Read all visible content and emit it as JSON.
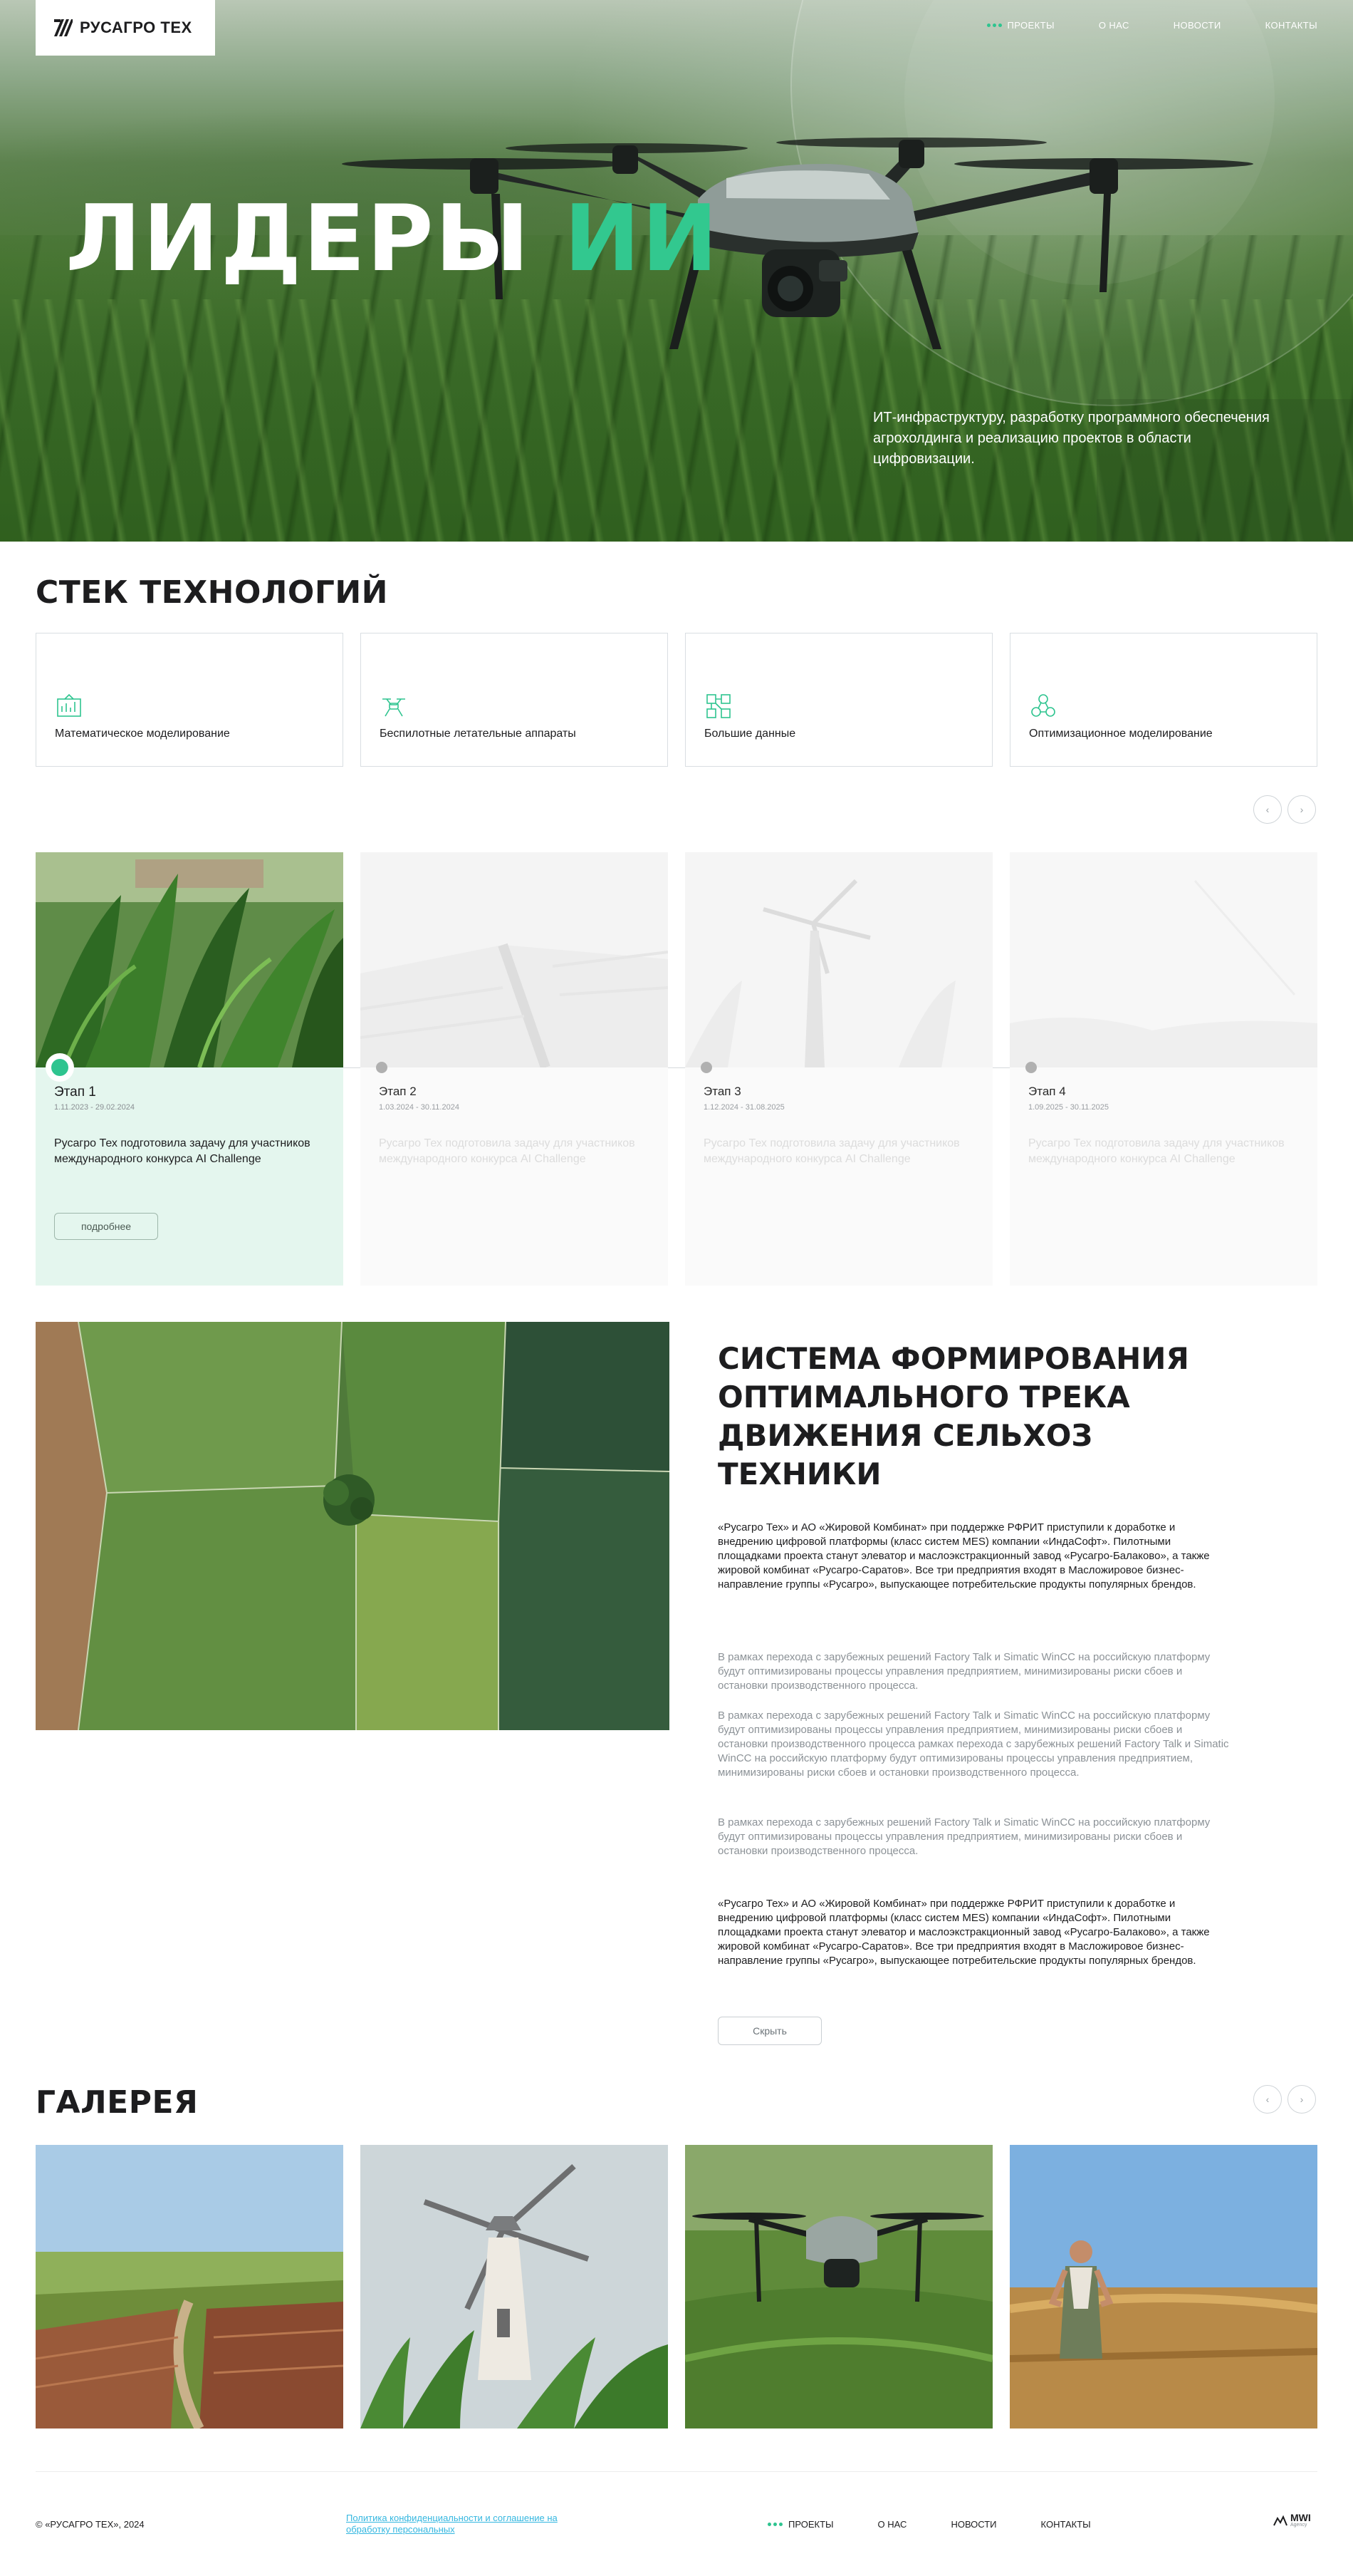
{
  "brand": {
    "name": "РУСАГРО ТЕХ"
  },
  "nav": {
    "items": [
      {
        "label": "ПРОЕКТЫ",
        "active": true
      },
      {
        "label": "О НАС"
      },
      {
        "label": "НОВОСТИ"
      },
      {
        "label": "КОНТАКТЫ"
      }
    ]
  },
  "hero": {
    "title_main": "ЛИДЕРЫ",
    "title_accent": "ИИ",
    "accent_color": "#32c88f",
    "description": "ИТ-инфраструктуру, разработку программного обеспечения агрохолдинга и реализацию проектов в области цифровизации."
  },
  "tech": {
    "title": "СТЕК ТЕХНОЛОГИЙ",
    "cards": [
      {
        "icon": "math-modeling-icon",
        "label": "Математическое моделирование"
      },
      {
        "icon": "drone-icon",
        "label": "Беспилотные летательные аппараты"
      },
      {
        "icon": "big-data-icon",
        "label": "Большие данные"
      },
      {
        "icon": "optimization-icon",
        "label": "Оптимизационное моделирование"
      }
    ]
  },
  "stages": [
    {
      "name": "Этап 1",
      "dates": "1.11.2023 - 29.02.2024",
      "text": "Русагро Тех подготовила задачу для участников международного конкурса AI Challenge",
      "button": "подробнее",
      "active": true
    },
    {
      "name": "Этап 2",
      "dates": "1.03.2024 - 30.11.2024",
      "text": "Русагро Тех подготовила задачу для участников международного конкурса AI Challenge"
    },
    {
      "name": "Этап 3",
      "dates": "1.12.2024 - 31.08.2025",
      "text": "Русагро Тех подготовила задачу для участников международного конкурса AI Challenge"
    },
    {
      "name": "Этап 4",
      "dates": "1.09.2025 - 30.11.2025",
      "text": "Русагро Тех подготовила задачу для участников международного конкурса AI Challenge"
    }
  ],
  "article": {
    "title": "СИСТЕМА ФОРМИРОВАНИЯ ОПТИМАЛЬНОГО ТРЕКА ДВИЖЕНИЯ СЕЛЬХОЗ ТЕХНИКИ",
    "p1": "«Русагро Тех» и АО «Жировой Комбинат» при поддержке РФРИТ приступили к доработке и внедрению цифровой платформы (класс систем MES) компании «ИндаСофт». Пилотными площадками проекта станут элеватор и маслоэкстракционный завод «Русагро-Балаково», а также жировой комбинат «Русагро-Саратов». Все три предприятия входят в Масложировое бизнес-направление группы «Русагро», выпускающее потребительские продукты популярных брендов.",
    "p2": "В рамках перехода с зарубежных решений Factory Talk и Simatic WinCC на российскую платформу будут оптимизированы процессы управления предприятием, минимизированы риски сбоев и остановки производственного процесса.",
    "p3": "В рамках перехода с зарубежных решений Factory Talk и Simatic WinCC на российскую платформу будут оптимизированы процессы управления предприятием, минимизированы риски сбоев и остановки производственного процесса рамках перехода с зарубежных решений Factory Talk и Simatic WinCC на российскую платформу будут оптимизированы процессы управления предприятием, минимизированы риски сбоев и остановки производственного процесса.",
    "p4": "В рамках перехода с зарубежных решений Factory Talk и Simatic WinCC на российскую платформу будут оптимизированы процессы управления предприятием, минимизированы риски сбоев и остановки производственного процесса.",
    "p5": "«Русагро Тех» и АО «Жировой Комбинат» при поддержке РФРИТ приступили к доработке и внедрению цифровой платформы (класс систем MES) компании «ИндаСофт». Пилотными площадками проекта станут элеватор и маслоэкстракционный завод «Русагро-Балаково», а также жировой комбинат «Русагро-Саратов». Все три предприятия входят в Масложировое бизнес-направление группы «Русагро», выпускающее потребительские продукты популярных брендов.",
    "hide_button": "Скрыть"
  },
  "gallery": {
    "title": "ГАЛЕРЕЯ",
    "items": [
      "field-road-photo",
      "windmill-photo",
      "drone-photo",
      "farmer-photo"
    ]
  },
  "footer": {
    "copyright": "© «РУСАГРО ТЕХ», 2024",
    "policy": "Политика конфиденциальности и соглашение на обработку персональных",
    "developer": "MWI",
    "developer_sub": "Agency"
  }
}
